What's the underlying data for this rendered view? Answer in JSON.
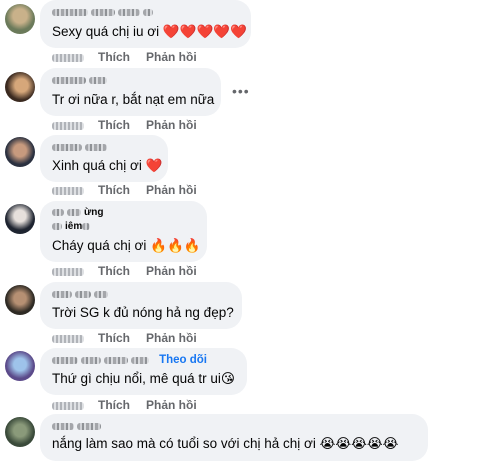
{
  "actions": {
    "like_label": "Thích",
    "reply_label": "Phản hồi"
  },
  "comments": [
    {
      "text": "Sexy quá chị iu ơi ❤️❤️❤️❤️❤️",
      "avatar_colors": [
        "#6b7a5a",
        "#c9b18a"
      ]
    },
    {
      "text": "Tr ơi nữa r, bắt nạt em nữa",
      "avatar_colors": [
        "#3b2a20",
        "#d6a77a"
      ],
      "more": "•••"
    },
    {
      "text": "Xinh quá chị ơi ❤️",
      "avatar_colors": [
        "#2b3140",
        "#c79a7e"
      ]
    },
    {
      "name_partial": "ừng",
      "name_line2": "iêm",
      "text": "Cháy quá chị ơi 🔥🔥🔥",
      "avatar_colors": [
        "#1e2430",
        "#e6e0dc"
      ]
    },
    {
      "text": "Trời SG k đủ nóng hả ng đẹp?",
      "avatar_colors": [
        "#2e2a24",
        "#b69073"
      ]
    },
    {
      "follow_label": "Theo dõi",
      "text": "Thứ gì chịu nổi, mê quá tr ui😘",
      "avatar_colors": [
        "#5b4a8a",
        "#9ec3ea"
      ]
    },
    {
      "text": "nắng làm sao mà có tuổi so với chị hả chị ơi 😭😭😭😭😭",
      "avatar_colors": [
        "#3a4a3a",
        "#8a9a7a"
      ]
    }
  ]
}
